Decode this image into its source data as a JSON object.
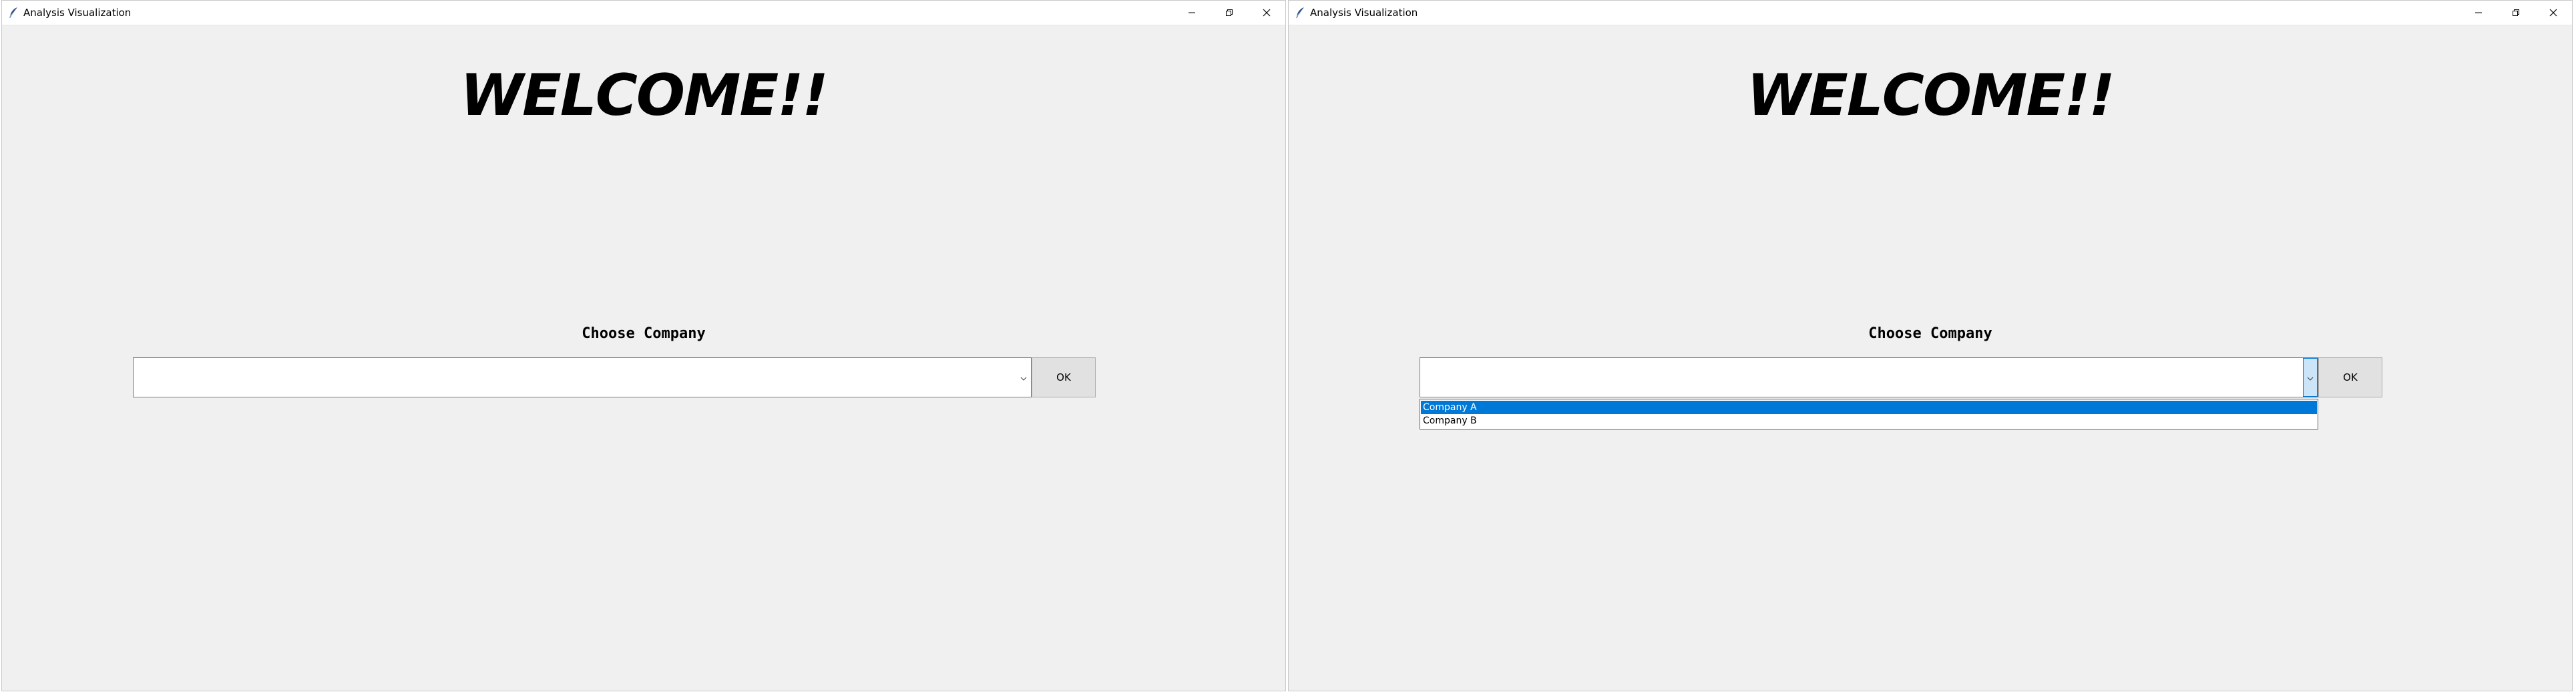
{
  "windows": [
    {
      "title": "Analysis Visualization",
      "heading": "WELCOME!!",
      "label": "Choose Company",
      "combobox_value": "",
      "ok_label": "OK",
      "dropdown_open": false
    },
    {
      "title": "Analysis Visualization",
      "heading": "WELCOME!!",
      "label": "Choose Company",
      "combobox_value": "",
      "ok_label": "OK",
      "dropdown_open": true,
      "options": [
        "Company A",
        "Company B"
      ],
      "highlighted_option": "Company A"
    }
  ],
  "icons": {
    "app": "feather-icon",
    "minimize": "minimize-icon",
    "restore": "restore-icon",
    "close": "close-icon",
    "dropdown": "chevron-down-icon"
  },
  "colors": {
    "window_bg": "#f0f0f0",
    "titlebar_bg": "#ffffff",
    "selection": "#0078d7",
    "arrow_hover": "#cce4f7"
  }
}
